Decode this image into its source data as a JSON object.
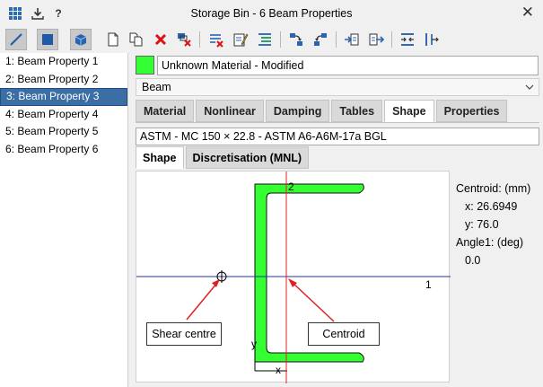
{
  "window": {
    "title": "Storage Bin - 6 Beam Properties"
  },
  "toolbar": {
    "tools": [
      {
        "name": "line-tool-icon",
        "active": true
      },
      {
        "name": "solid-square-icon",
        "active": true
      },
      {
        "name": "cube-icon",
        "active": true
      },
      {
        "name": "new-page-icon"
      },
      {
        "name": "copy-icon"
      },
      {
        "name": "delete-icon"
      },
      {
        "name": "delete-filter-icon"
      },
      {
        "name": "clear-list-icon"
      },
      {
        "name": "edit-icon"
      },
      {
        "name": "properties-list-icon"
      },
      {
        "name": "assign-icon"
      },
      {
        "name": "reassign-icon"
      },
      {
        "name": "import-icon"
      },
      {
        "name": "export-icon"
      },
      {
        "name": "fit-horizontal-icon"
      },
      {
        "name": "fit-vertical-icon"
      }
    ]
  },
  "properties_list": {
    "items": [
      "1: Beam Property 1",
      "2: Beam Property 2",
      "3: Beam Property 3",
      "4: Beam Property 4",
      "5: Beam Property 5",
      "6: Beam Property 6"
    ],
    "selected_index": 2
  },
  "material": {
    "swatch_color": "#33ff33",
    "name": "Unknown Material - Modified"
  },
  "element_type": {
    "value": "Beam"
  },
  "tabs": [
    "Material",
    "Nonlinear",
    "Damping",
    "Tables",
    "Shape",
    "Properties"
  ],
  "active_tab": "Shape",
  "section": {
    "value": "ASTM - MC 150 × 22.8 - ASTM A6-A6M-17a BGL"
  },
  "subtabs": [
    "Shape",
    "Discretisation (MNL)"
  ],
  "active_subtab": "Shape",
  "diagram": {
    "axis_2_label": "2",
    "axis_1_label": "1",
    "x_label": "x",
    "y_label": "y",
    "shear_centre_label": "Shear centre",
    "centroid_label": "Centroid",
    "fill_color": "#33ff33"
  },
  "section_props": {
    "centroid_label": "Centroid: (mm)",
    "x": "x: 26.6949",
    "y": "y: 76.0",
    "angle_label": "Angle1: (deg)",
    "angle": "0.0"
  }
}
